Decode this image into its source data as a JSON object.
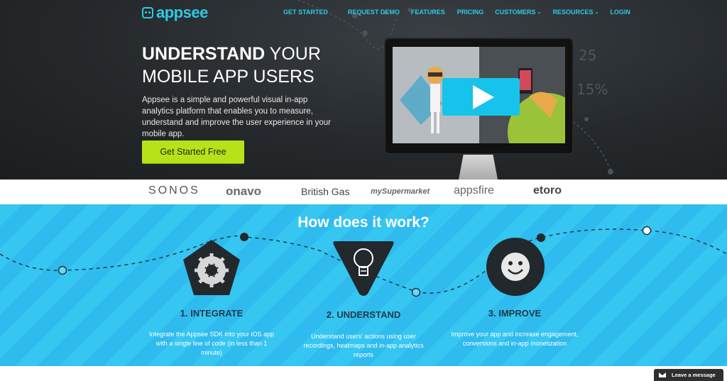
{
  "brand": {
    "logo_text": "appsee",
    "accent": "#2ec9e6",
    "cta_color": "#b6e21a",
    "steps_bg": "#36c6f2"
  },
  "nav": {
    "items": [
      {
        "label": "GET STARTED"
      },
      {
        "label": "REQUEST DEMO"
      },
      {
        "label": "FEATURES"
      },
      {
        "label": "PRICING"
      },
      {
        "label": "CUSTOMERS",
        "dropdown": true
      },
      {
        "label": "RESOURCES",
        "dropdown": true
      },
      {
        "label": "LOGIN"
      }
    ]
  },
  "hero": {
    "title_bold": "UNDERSTAND",
    "title_rest": " YOUR",
    "title_line2": "MOBILE APP USERS",
    "description": "Appsee is a simple and powerful visual in-app analytics platform that enables you to measure, understand and improve the user experience in your mobile app.",
    "cta_label": "Get Started Free",
    "video": {
      "icon": "play-icon"
    },
    "bg_numbers": [
      "25",
      "15%"
    ]
  },
  "clients": [
    "SONOS",
    "onavo",
    "British Gas",
    "mySupermarket",
    "appsfire",
    "etoro"
  ],
  "how": {
    "title_light": "How does it ",
    "title_bold": "work?",
    "steps": [
      {
        "icon": "gear-icon",
        "title": "1. INTEGRATE",
        "text": "Integrate the Appsee SDK into your iOS app with a single line of code (in less than 1 minute)"
      },
      {
        "icon": "lightbulb-icon",
        "title": "2. UNDERSTAND",
        "text": "Understand users' actions using user recordings, heatmaps and in-app analytics reports"
      },
      {
        "icon": "smiley-icon",
        "title": "3. IMPROVE",
        "text": "Improve your app and increase engagement, conversions and in-app monetization"
      }
    ]
  },
  "chat": {
    "label": "Leave a message",
    "icon": "envelope-icon"
  }
}
